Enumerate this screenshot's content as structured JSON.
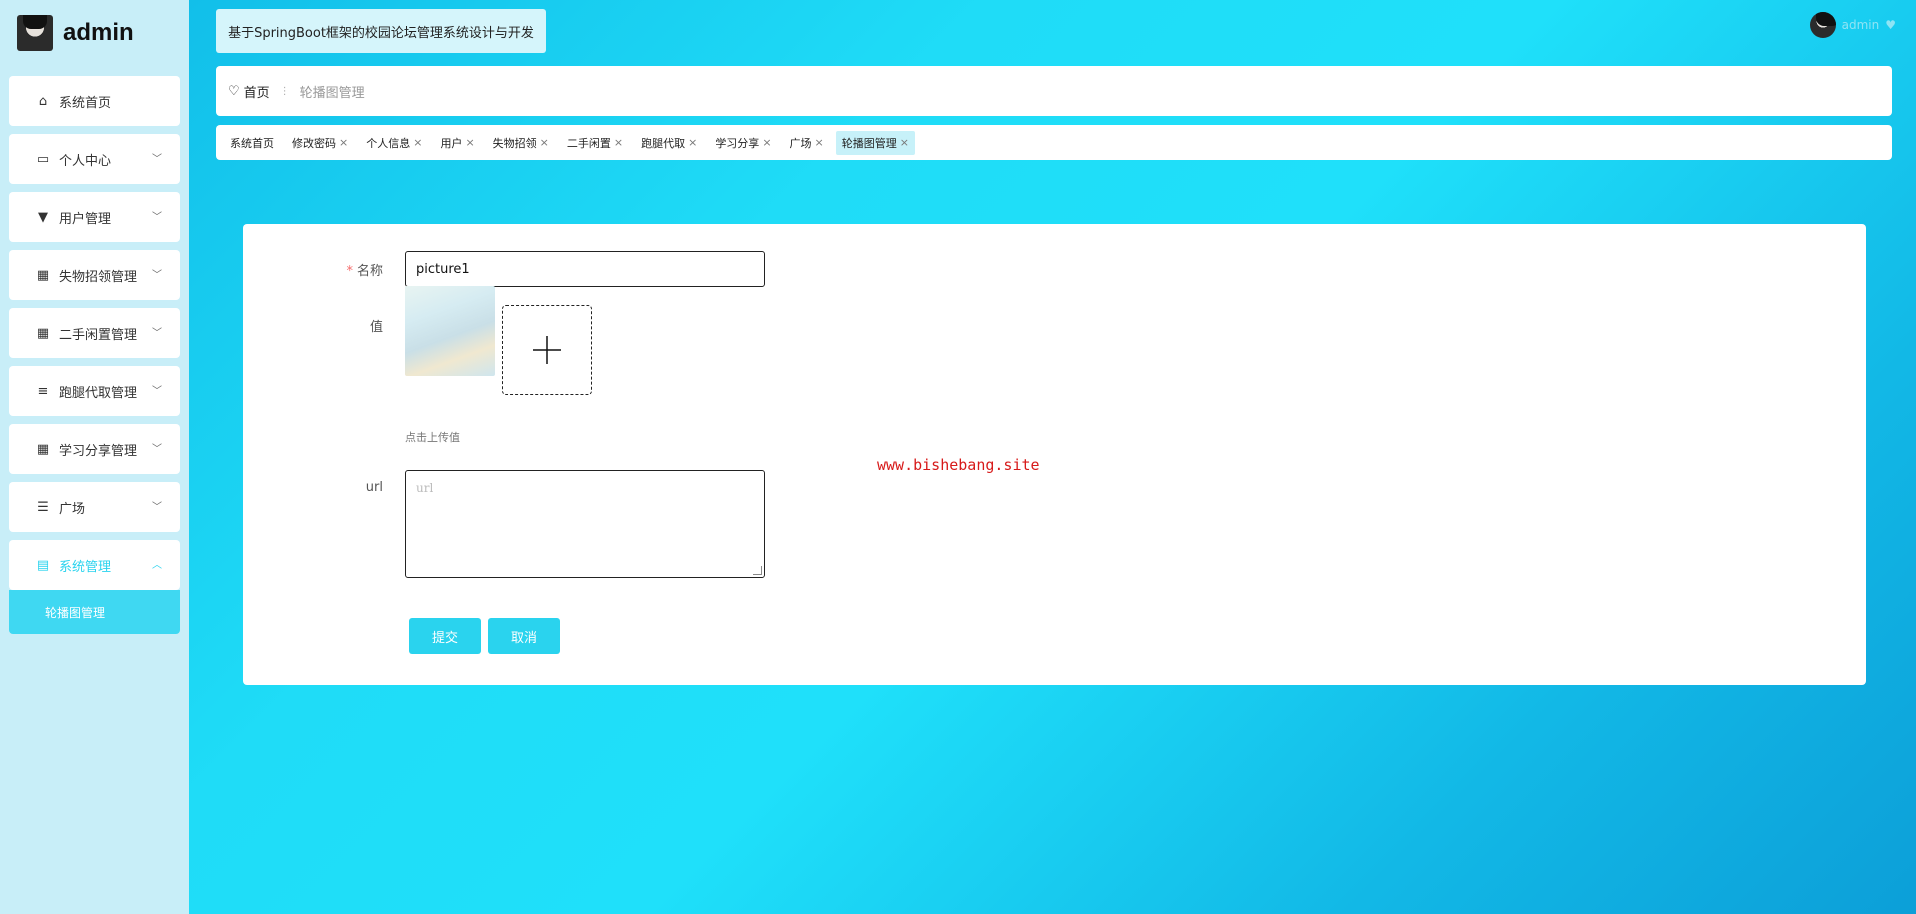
{
  "brand": {
    "name": "admin"
  },
  "sidebar": {
    "items": [
      {
        "label": "系统首页",
        "icon": "home-icon",
        "has_chevron": false
      },
      {
        "label": "个人中心",
        "icon": "wallet-icon",
        "has_chevron": true
      },
      {
        "label": "用户管理",
        "icon": "user-manage-icon",
        "has_chevron": true
      },
      {
        "label": "失物招领管理",
        "icon": "grid-icon",
        "has_chevron": true
      },
      {
        "label": "二手闲置管理",
        "icon": "grid-icon",
        "has_chevron": true
      },
      {
        "label": "跑腿代取管理",
        "icon": "list-icon",
        "has_chevron": true
      },
      {
        "label": "学习分享管理",
        "icon": "grid-icon",
        "has_chevron": true
      },
      {
        "label": "广场",
        "icon": "list-icon",
        "has_chevron": true
      },
      {
        "label": "系统管理",
        "icon": "system-icon",
        "has_chevron": true,
        "expanded": true
      }
    ],
    "submenu": [
      {
        "label": "轮播图管理"
      }
    ]
  },
  "header": {
    "title": "基于SpringBoot框架的校园论坛管理系统设计与开发",
    "user": "admin"
  },
  "breadcrumb": {
    "home": "首页",
    "current": "轮播图管理"
  },
  "tabs": [
    {
      "label": "系统首页",
      "closable": false
    },
    {
      "label": "修改密码",
      "closable": true
    },
    {
      "label": "个人信息",
      "closable": true
    },
    {
      "label": "用户",
      "closable": true
    },
    {
      "label": "失物招领",
      "closable": true
    },
    {
      "label": "二手闲置",
      "closable": true
    },
    {
      "label": "跑腿代取",
      "closable": true
    },
    {
      "label": "学习分享",
      "closable": true
    },
    {
      "label": "广场",
      "closable": true
    },
    {
      "label": "轮播图管理",
      "closable": true,
      "active": true
    }
  ],
  "form": {
    "name_label": "名称",
    "name_value": "picture1",
    "value_label": "值",
    "upload_hint": "点击上传值",
    "url_label": "url",
    "url_placeholder": "url",
    "submit": "提交",
    "cancel": "取消"
  },
  "watermark": "www.bishebang.site",
  "colors": {
    "accent": "#2ad3ee",
    "sidebar_bg": "#c8eef8",
    "required": "#f56c6c"
  }
}
